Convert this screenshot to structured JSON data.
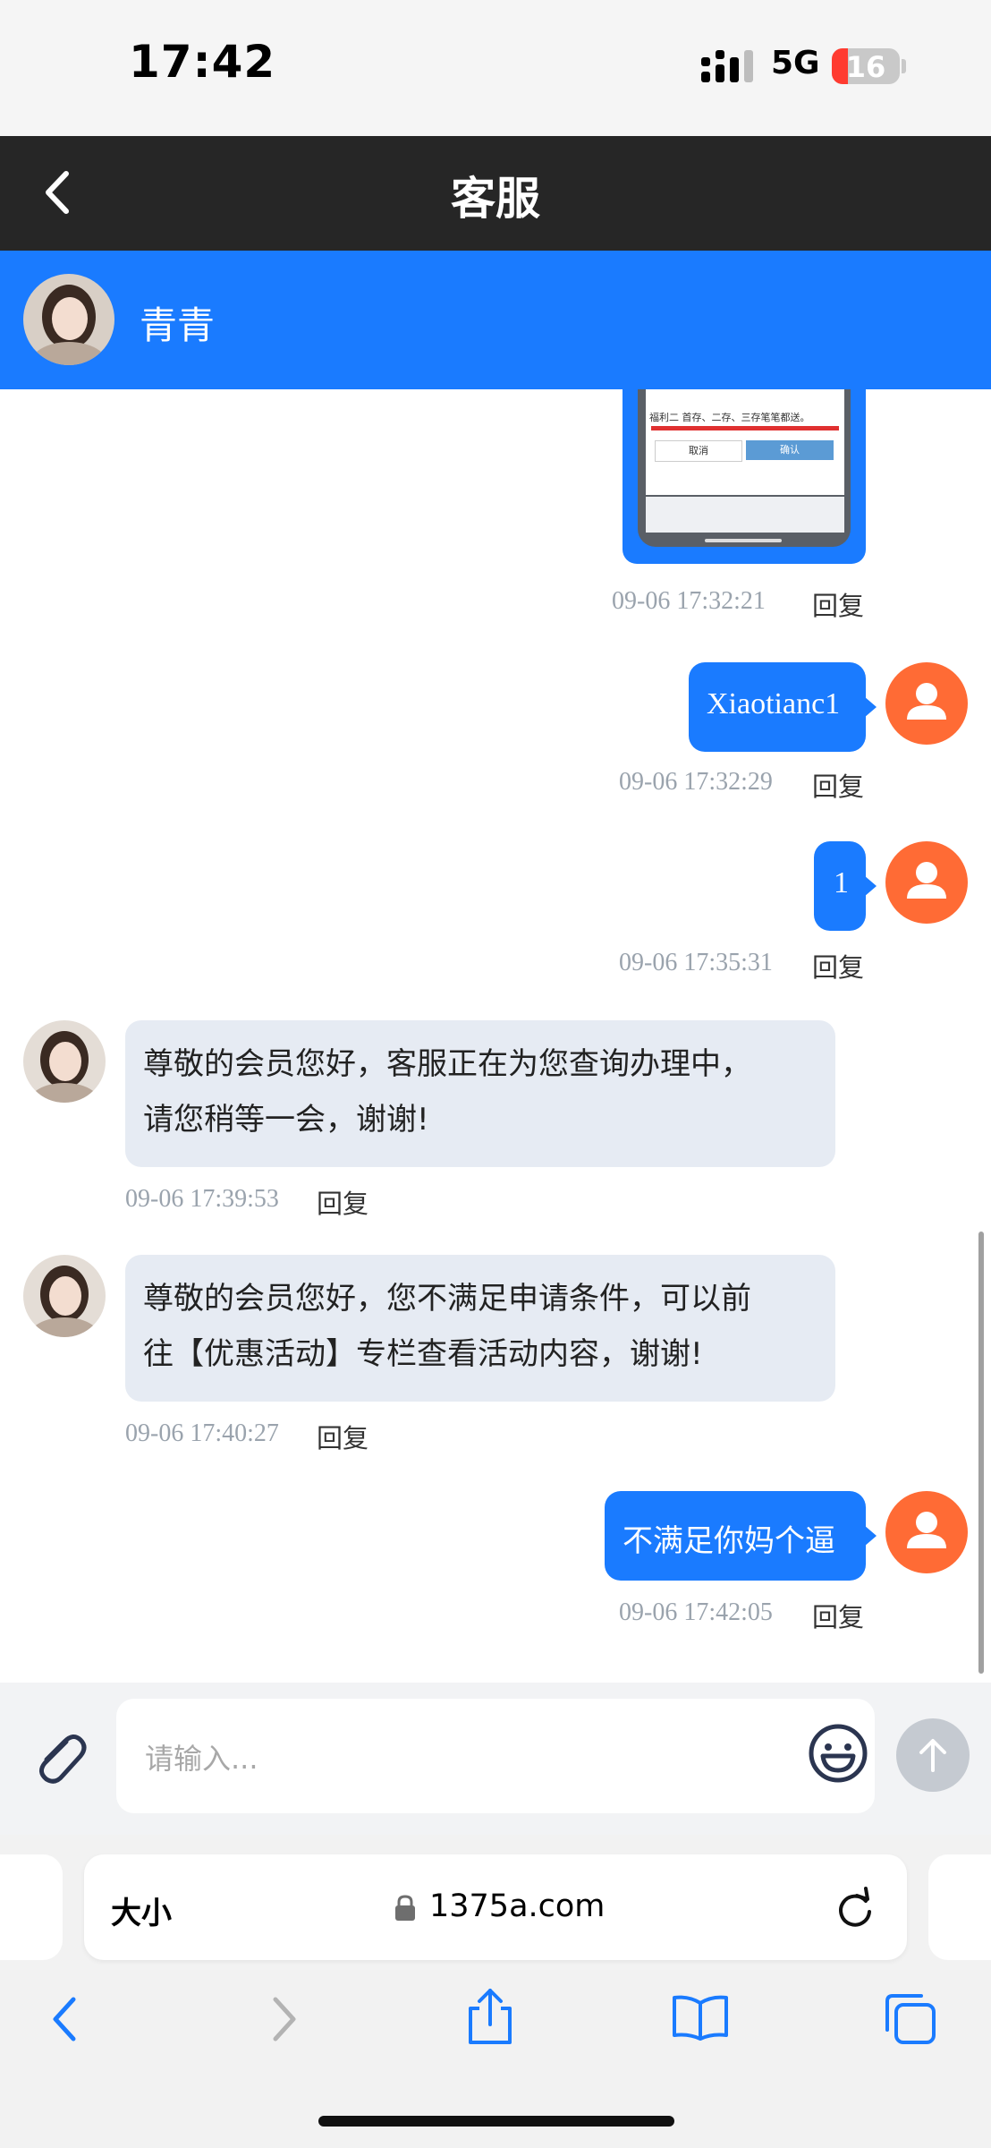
{
  "status_bar": {
    "time": "17:42",
    "network": "5G",
    "battery": "16"
  },
  "header": {
    "title": "客服"
  },
  "agent": {
    "name": "青青"
  },
  "image_message": {
    "fragment_text": "福利二 首存、二存、三存笔笔都送。",
    "cancel_label": "取消",
    "confirm_label": "确认",
    "timestamp": "09-06 17:32:21",
    "reply_label": "回复"
  },
  "messages": [
    {
      "direction": "out",
      "text": "Xiaotianc1",
      "timestamp": "09-06 17:32:29",
      "reply_label": "回复"
    },
    {
      "direction": "out",
      "text": "1",
      "timestamp": "09-06 17:35:31",
      "reply_label": "回复"
    },
    {
      "direction": "in",
      "line1": "尊敬的会员您好，客服正在为您查询办理中，",
      "line2": "请您稍等一会，谢谢!",
      "timestamp": "09-06 17:39:53",
      "reply_label": "回复"
    },
    {
      "direction": "in",
      "line1": "尊敬的会员您好，您不满足申请条件，可以前",
      "line2": "往【优惠活动】专栏查看活动内容，谢谢!",
      "timestamp": "09-06 17:40:27",
      "reply_label": "回复"
    },
    {
      "direction": "out",
      "text": "不满足你妈个逼",
      "timestamp": "09-06 17:42:05",
      "reply_label": "回复"
    }
  ],
  "composer": {
    "placeholder": "请输入..."
  },
  "browser": {
    "text_size": "大小",
    "url": "1375a.com"
  },
  "icons": [
    "back-chevron-icon",
    "attach-icon",
    "emoji-icon",
    "send-arrow-icon",
    "lock-icon",
    "reload-icon",
    "nav-back-icon",
    "nav-forward-icon",
    "share-icon",
    "bookmarks-icon",
    "tabs-icon",
    "user-icon"
  ],
  "colors": {
    "accent": "#1a7bff",
    "header": "#262626",
    "user_avatar": "#ff6b35",
    "incoming_bubble": "#e6ebf3"
  }
}
